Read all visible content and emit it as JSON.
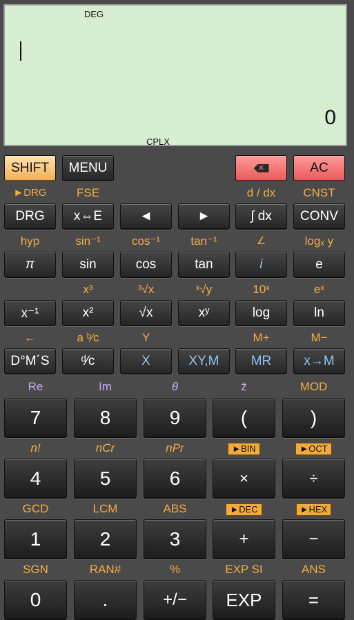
{
  "display": {
    "mode_top": "DEG",
    "mode_bottom": "CPLX",
    "value": "0"
  },
  "keys": {
    "shift": "SHIFT",
    "menu": "MENU",
    "ac": "AC",
    "drg": "DRG",
    "xe": "x⇔E",
    "left": "◄",
    "right": "►",
    "integral": "∫ dx",
    "conv": "CONV",
    "pi": "π",
    "sin": "sin",
    "cos": "cos",
    "tan": "tan",
    "i": "i",
    "e": "e",
    "xinv": "x⁻¹",
    "x2": "x²",
    "sqrt": "√x",
    "xy": "xʸ",
    "log": "log",
    "ln": "ln",
    "dms": "D°M´S",
    "dc": "ᵈ⁄c",
    "x": "X",
    "xym": "XY,M",
    "mr": "MR",
    "xm": "x→M",
    "n7": "7",
    "n8": "8",
    "n9": "9",
    "lparen": "(",
    "rparen": ")",
    "n4": "4",
    "n5": "5",
    "n6": "6",
    "mul": "×",
    "div": "÷",
    "n1": "1",
    "n2": "2",
    "n3": "3",
    "add": "+",
    "sub": "−",
    "n0": "0",
    "dot": ".",
    "pm": "+/−",
    "exp": "EXP",
    "eq": "="
  },
  "labels": {
    "r1": [
      "►DRG",
      "FSE",
      "d / dx",
      "CNST"
    ],
    "r2": [
      "hyp",
      "sin⁻¹",
      "cos⁻¹",
      "tan⁻¹",
      "∠",
      "logₓ y"
    ],
    "r3": [
      "x³",
      "³√x",
      "ˣ√y",
      "10ˣ",
      "eˣ"
    ],
    "r4": [
      "←",
      "a ᵇ⁄c",
      "Y",
      "M+",
      "M−"
    ],
    "r5": [
      "Re",
      "Im",
      "θ",
      "z̄",
      "MOD"
    ],
    "r6": [
      "n!",
      "nCr",
      "nPr",
      "►BIN",
      "►OCT"
    ],
    "r7": [
      "GCD",
      "LCM",
      "ABS",
      "►DEC",
      "►HEX"
    ],
    "r8": [
      "SGN",
      "RAN#",
      "%",
      "EXP SI",
      "ANS"
    ]
  },
  "colors": {
    "accent_orange": "#f5ad42",
    "accent_blue": "#8fc3f2",
    "accent_purple": "#c6a8ee",
    "shift_key": "#f1ae52",
    "clear_keys": "#ea5a5a",
    "display_bg": "#d7eed3"
  }
}
